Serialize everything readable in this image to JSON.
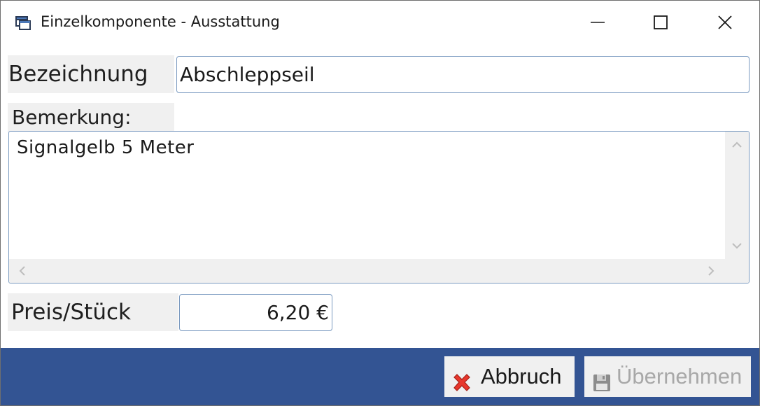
{
  "window": {
    "title": "Einzelkomponente - Ausstattung",
    "icon": "form-icon",
    "controls": [
      "minimize",
      "maximize",
      "close"
    ]
  },
  "form": {
    "bezeichnung_label": "Bezeichnung",
    "bezeichnung_value": "Abschleppseil",
    "bemerkung_label": "Bemerkung:",
    "bemerkung_value": "Signalgelb 5 Meter",
    "preis_label": "Preis/Stück",
    "preis_value": "6,20 €"
  },
  "footer": {
    "abbruch_label": "Abbruch",
    "abbruch_icon": "red-x-icon",
    "uebernehmen_label": "Übernehmen",
    "uebernehmen_icon": "floppy-disk-icon",
    "uebernehmen_disabled": true
  },
  "colors": {
    "footer_bg": "#335493",
    "label_bg": "#f0f0f0",
    "input_border": "#7a9ac0",
    "cancel_icon": "#e8372c"
  }
}
